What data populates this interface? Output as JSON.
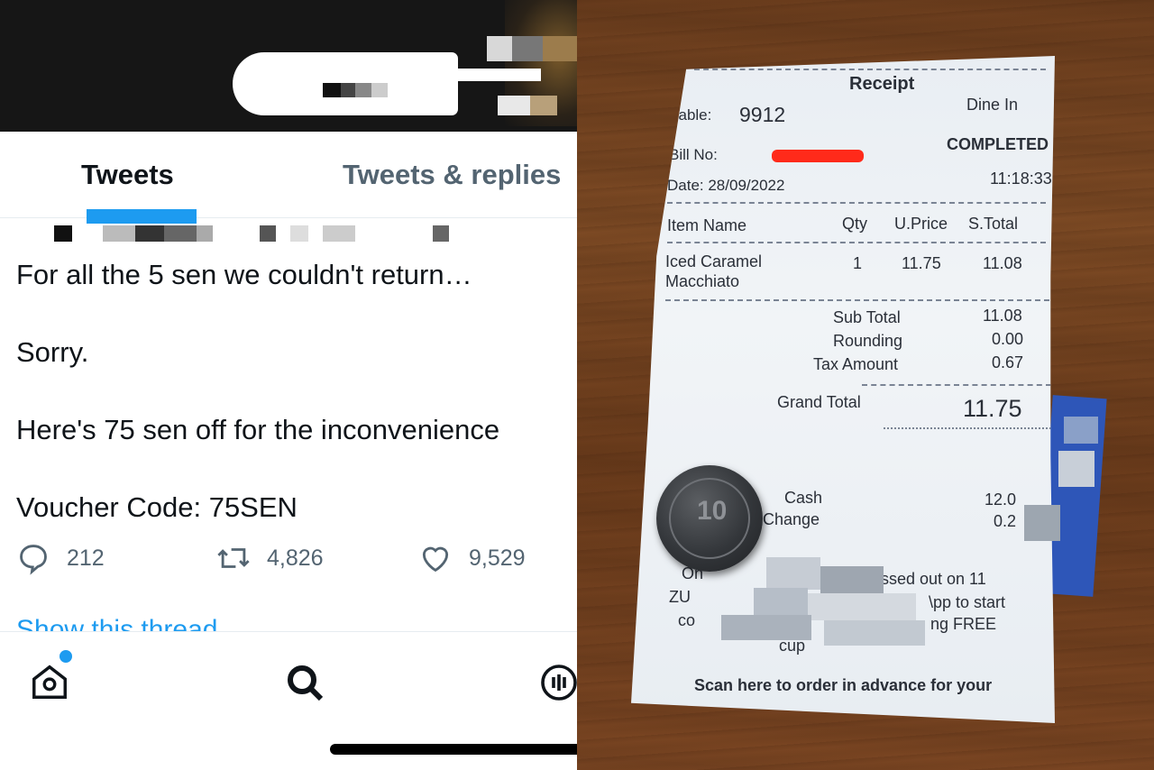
{
  "tabs": {
    "tweets": "Tweets",
    "tweets_and_replies": "Tweets & replies"
  },
  "tweet": {
    "line1": "For all the 5 sen we couldn't return…",
    "line2": "Sorry.",
    "line3": "Here's 75 sen off for the inconvenience",
    "line4": "Voucher Code: 75SEN",
    "replies": "212",
    "retweets": "4,826",
    "likes": "9,529",
    "show_thread": "Show this thread"
  },
  "icons": {
    "reply": "speech-bubble-icon",
    "retweet": "retweet-arrows-icon",
    "like": "heart-icon",
    "home": "home-icon",
    "search": "search-icon",
    "spaces": "spaces-microphone-icon"
  },
  "colors": {
    "twitter_blue": "#1d9bf0",
    "text_dark": "#0f1419",
    "text_muted": "#536471",
    "redaction_red": "#ff2a1a"
  },
  "receipt": {
    "title": "Receipt",
    "table_label": "Table:",
    "table_value": "9912",
    "dine": "Dine In",
    "bill_label": "Bill No:",
    "status": "COMPLETED",
    "date": "Date: 28/09/2022",
    "time": "11:18:33",
    "columns": [
      "Item Name",
      "Qty",
      "U.Price",
      "S.Total"
    ],
    "item_name_1": "Iced Caramel",
    "item_name_2": "Macchiato",
    "item_qty": "1",
    "item_price": "11.75",
    "item_subtotal": "11.08",
    "sub_total_label": "Sub Total",
    "sub_total": "11.08",
    "rounding_label": "Rounding",
    "rounding": "0.00",
    "tax_label": "Tax Amount",
    "tax": "0.67",
    "grand_total_label": "Grand Total",
    "grand_total": "11.75",
    "cash_label": "Cash",
    "cash": "12.0",
    "change_label": "Change",
    "change": "0.2",
    "promo_1": "missed out on 11",
    "promo_1_prefix": "On",
    "promo_2_prefix": "ZU",
    "promo_2": "\\pp to start",
    "promo_3_prefix": "co",
    "promo_3": "ng FREE",
    "promo_4": "cup",
    "footer": "Scan here to order in advance for your",
    "coin_value": "10"
  }
}
